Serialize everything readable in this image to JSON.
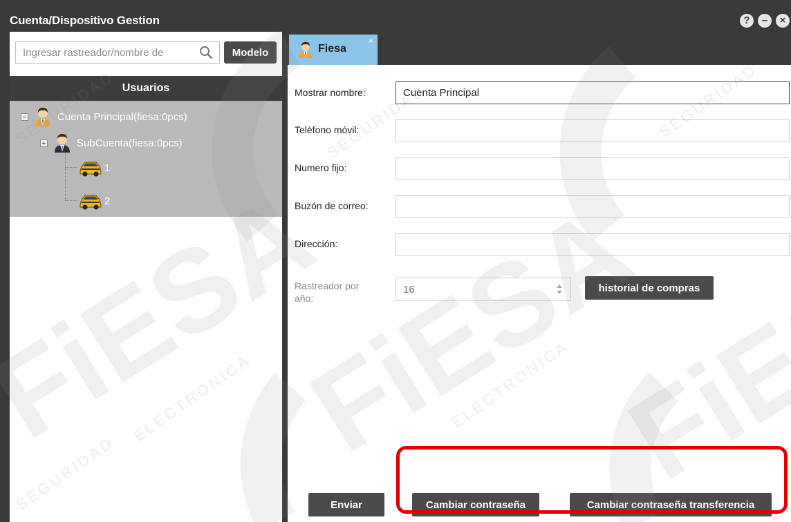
{
  "window": {
    "title": "Cuenta/Dispositivo Gestion",
    "buttons": [
      "?",
      "–",
      "×"
    ]
  },
  "left": {
    "search": {
      "placeholder": "Ingresar rastreador/nombre de"
    },
    "model_button": "Modelo",
    "users_header": "Usuarios",
    "tree": {
      "root": "Cuenta Principal(fiesa:0pcs)",
      "child": "SubCuenta(fiesa:0pcs)",
      "devices": [
        "1",
        "2"
      ]
    }
  },
  "right": {
    "tab": {
      "label": "Fiesa",
      "close": "×"
    },
    "form": {
      "display_name": {
        "label": "Mostrar nombre:",
        "value": "Cuenta Principal"
      },
      "mobile": {
        "label": "Teléfono móvil:",
        "value": ""
      },
      "landline": {
        "label": "Numero fijo:",
        "value": ""
      },
      "mailbox": {
        "label": "Buzón de correo:",
        "value": ""
      },
      "address": {
        "label": "Dirección:",
        "value": ""
      },
      "trackers_per_year": {
        "label_line1": "Rastreador por",
        "label_line2": "año:",
        "value": "16"
      }
    },
    "purchase_history_button": "historial de compras",
    "buttons": {
      "send": "Enviar",
      "change_password": "Cambiar contraseña",
      "change_transfer_password": "Cambiar contraseña transferencia"
    }
  },
  "watermark": {
    "brand": "FiESA",
    "line1": "SEGURIDAD",
    "line2": "ELECTRONICA"
  },
  "colors": {
    "titlebar": "#3a3a3a",
    "tab_active": "#8cc4ea",
    "tree_bg": "#b9b9b9",
    "button": "#4a4a4a",
    "highlight": "#e10000"
  }
}
